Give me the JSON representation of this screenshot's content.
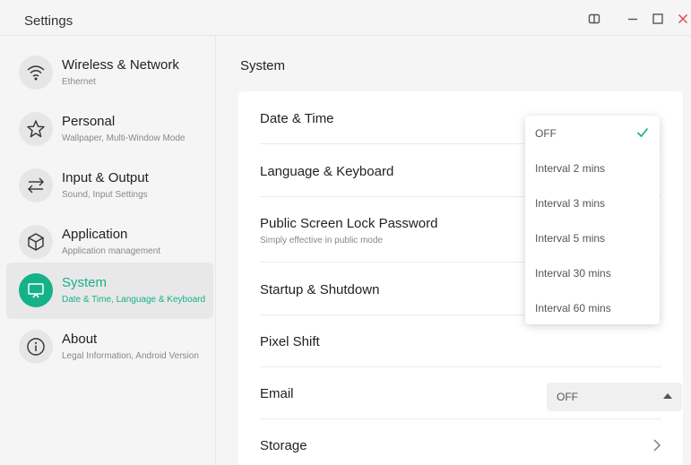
{
  "window": {
    "title": "Settings"
  },
  "sidebar": {
    "items": [
      {
        "label": "Wireless & Network",
        "sub": "Ethernet",
        "icon": "wifi-icon",
        "active": false
      },
      {
        "label": "Personal",
        "sub": "Wallpaper, Multi-Window Mode",
        "icon": "star-icon",
        "active": false
      },
      {
        "label": "Input & Output",
        "sub": "Sound, Input Settings",
        "icon": "swap-icon",
        "active": false
      },
      {
        "label": "Application",
        "sub": "Application management",
        "icon": "cube-icon",
        "active": false
      },
      {
        "label": "System",
        "sub": "Date & Time, Language & Keyboard",
        "icon": "monitor-icon",
        "active": true
      },
      {
        "label": "About",
        "sub": "Legal Information, Android Version",
        "icon": "info-icon",
        "active": false
      }
    ]
  },
  "main": {
    "title": "System",
    "rows": [
      {
        "label": "Date & Time"
      },
      {
        "label": "Language & Keyboard"
      },
      {
        "label": "Public Screen Lock Password",
        "sub": "Simply effective in public mode"
      },
      {
        "label": "Startup & Shutdown"
      },
      {
        "label": "Pixel Shift",
        "value": "OFF"
      },
      {
        "label": "Email"
      },
      {
        "label": "Storage"
      }
    ]
  },
  "dropdown": {
    "options": [
      "OFF",
      "Interval 2 mins",
      "Interval 3 mins",
      "Interval 5 mins",
      "Interval 30 mins",
      "Interval 60 mins"
    ],
    "selected": "OFF"
  },
  "colors": {
    "accent": "#15b28a",
    "close": "#e24a4a"
  }
}
